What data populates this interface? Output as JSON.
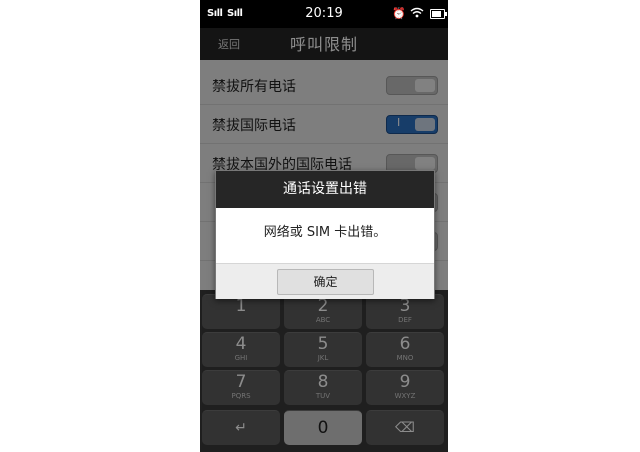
{
  "status_bar": {
    "signal1": "Sıll",
    "signal2": "Sıll",
    "time": "20:19",
    "icons": [
      "alarm-icon",
      "wifi-icon",
      "battery-icon"
    ]
  },
  "header": {
    "back_label": "返回",
    "title": "呼叫限制"
  },
  "settings": [
    {
      "label": "禁拔所有电话",
      "on": false
    },
    {
      "label": "禁拔国际电话",
      "on": true
    },
    {
      "label": "禁拔本国外的国际电话",
      "on": false
    },
    {
      "label": "",
      "on": false
    },
    {
      "label": "",
      "on": false
    }
  ],
  "dialog": {
    "title": "通话设置出错",
    "message": "网络或 SIM 卡出错。",
    "ok_label": "确定"
  },
  "keypad": {
    "keys": [
      {
        "num": "1",
        "letters": ""
      },
      {
        "num": "2",
        "letters": "ABC"
      },
      {
        "num": "3",
        "letters": "DEF"
      },
      {
        "num": "4",
        "letters": "GHI"
      },
      {
        "num": "5",
        "letters": "JKL"
      },
      {
        "num": "6",
        "letters": "MNO"
      },
      {
        "num": "7",
        "letters": "PQRS"
      },
      {
        "num": "8",
        "letters": "TUV"
      },
      {
        "num": "9",
        "letters": "WXYZ"
      }
    ],
    "enter_glyph": "↵",
    "zero": "0",
    "delete_glyph": "⌫"
  },
  "colors": {
    "toggle_on": "#2a6fc0",
    "bar_dark": "#262626"
  }
}
